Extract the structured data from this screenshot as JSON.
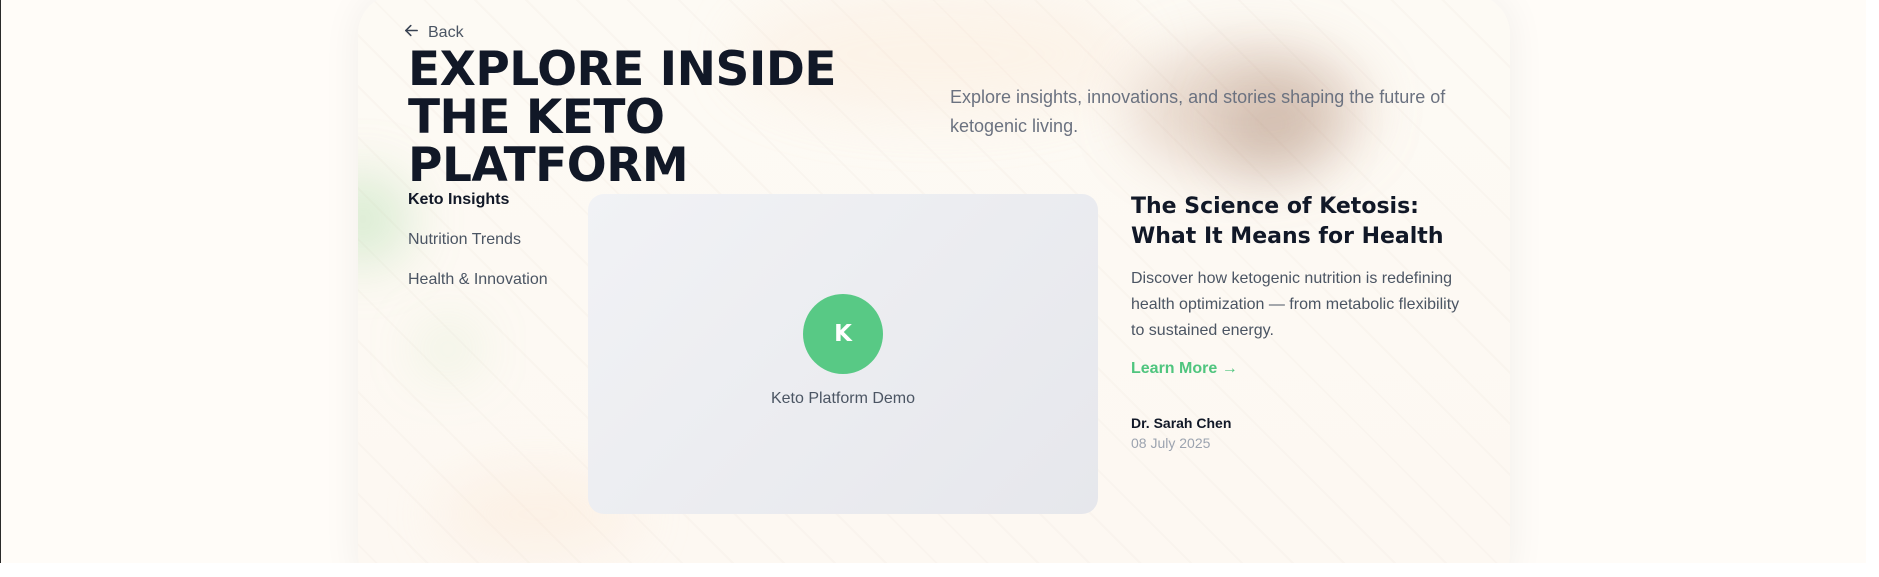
{
  "nav": {
    "back_label": "Back",
    "back_icon": "arrow-left-icon"
  },
  "hero": {
    "title": "EXPLORE INSIDE THE KETO PLATFORM",
    "subtitle": "Explore insights, innovations, and stories shaping the future of ketogenic living."
  },
  "categories": [
    {
      "label": "Keto Insights",
      "active": true
    },
    {
      "label": "Nutrition Trends",
      "active": false
    },
    {
      "label": "Health & Innovation",
      "active": false
    }
  ],
  "media": {
    "logo_letter": "K",
    "caption": "Keto Platform Demo"
  },
  "article": {
    "title": "The Science of Ketosis: What It Means for Health",
    "body": "Discover how ketogenic nutrition is redefining health optimization — from metabolic flexibility to sustained energy.",
    "cta_label": "Learn More →",
    "author": "Dr. Sarah Chen",
    "date": "08 July 2025"
  },
  "colors": {
    "accent": "#58c985",
    "title": "#111827",
    "muted": "#6b7280",
    "background": "#fffcf8"
  }
}
